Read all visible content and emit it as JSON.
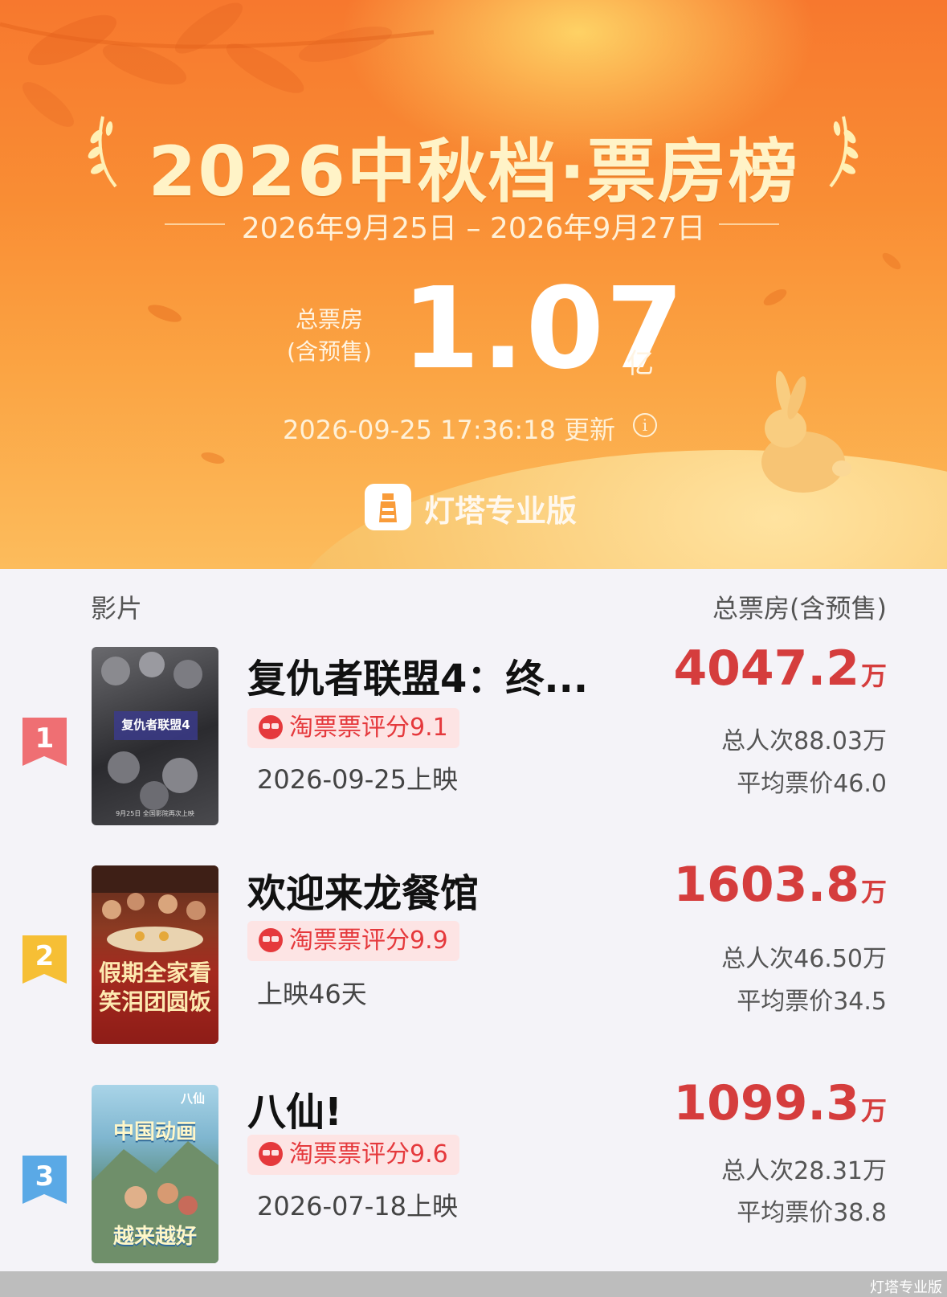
{
  "header": {
    "title": "2026中秋档·票房榜",
    "date_range": "2026年9月25日 – 2026年9月27日",
    "total_label_line1": "总票房",
    "total_label_line2": "(含预售)",
    "total_value": "1.07",
    "total_unit": "亿",
    "updated": "2026-09-25 17:36:18 更新",
    "brand": "灯塔专业版"
  },
  "list": {
    "col_left": "影片",
    "col_right": "总票房(含预售)",
    "items": [
      {
        "rank": "1",
        "title": "复仇者联盟4：终...",
        "rating": "淘票票评分9.1",
        "release": "2026-09-25上映",
        "gross": "4047.2",
        "gross_unit": "万",
        "admissions": "总人次88.03万",
        "avg_price": "平均票价46.0",
        "poster_text": "复仇者联盟4",
        "poster_sub": "9月25日 全国影院再次上映"
      },
      {
        "rank": "2",
        "title": "欢迎来龙餐馆",
        "rating": "淘票票评分9.9",
        "release": "上映46天",
        "gross": "1603.8",
        "gross_unit": "万",
        "admissions": "总人次46.50万",
        "avg_price": "平均票价34.5",
        "poster_text": "假期全家看",
        "poster_text2": "笑泪团圆饭"
      },
      {
        "rank": "3",
        "title": "八仙!",
        "rating": "淘票票评分9.6",
        "release": "2026-07-18上映",
        "gross": "1099.3",
        "gross_unit": "万",
        "admissions": "总人次28.31万",
        "avg_price": "平均票价38.8",
        "poster_text": "中国动画",
        "poster_text2": "越来越好",
        "poster_logo": "八仙"
      }
    ]
  },
  "watermark": "灯塔专业版",
  "colors": {
    "rank1": "#ef6f73",
    "rank2": "#f6bf35",
    "rank3": "#5aa9e6",
    "gross": "#d53d3d",
    "rating_bg": "#fde4e4"
  }
}
